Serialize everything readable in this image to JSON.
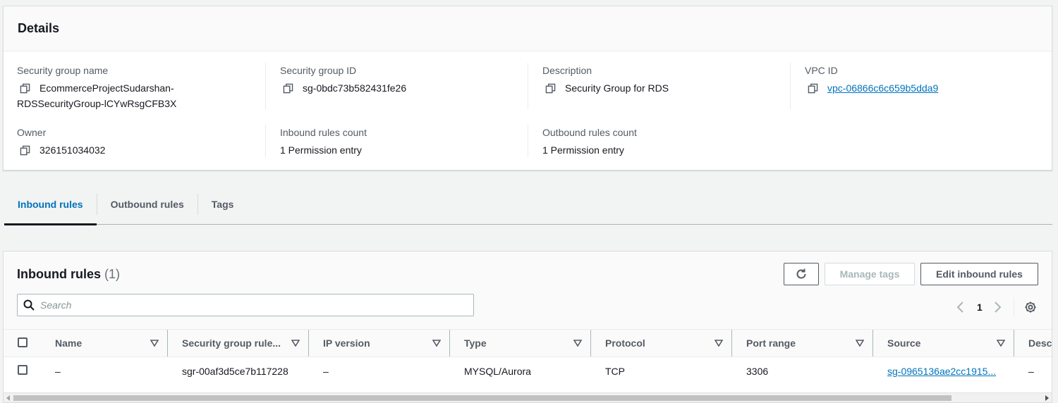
{
  "details": {
    "title": "Details",
    "fields": {
      "sg_name_label": "Security group name",
      "sg_name_value_1": "EcommerceProjectSudarshan-",
      "sg_name_value_2": "RDSSecurityGroup-lCYwRsgCFB3X",
      "sg_id_label": "Security group ID",
      "sg_id_value": "sg-0bdc73b582431fe26",
      "description_label": "Description",
      "description_value": "Security Group for RDS",
      "vpc_label": "VPC ID",
      "vpc_value": "vpc-06866c6c659b5dda9",
      "owner_label": "Owner",
      "owner_value": "326151034032",
      "inbound_count_label": "Inbound rules count",
      "inbound_count_value": "1 Permission entry",
      "outbound_count_label": "Outbound rules count",
      "outbound_count_value": "1 Permission entry"
    }
  },
  "tabs": [
    {
      "label": "Inbound rules",
      "active": true
    },
    {
      "label": "Outbound rules",
      "active": false
    },
    {
      "label": "Tags",
      "active": false
    }
  ],
  "rules": {
    "title": "Inbound rules",
    "count": "(1)",
    "refresh_icon": "refresh-icon",
    "manage_tags_label": "Manage tags",
    "edit_label": "Edit inbound rules",
    "search_placeholder": "Search",
    "page_number": "1",
    "columns": [
      "Name",
      "Security group rule...",
      "IP version",
      "Type",
      "Protocol",
      "Port range",
      "Source",
      "Descr"
    ],
    "rows": [
      {
        "name": "–",
        "rule_id": "sgr-00af3d5ce7b117228",
        "ip_version": "–",
        "type": "MYSQL/Aurora",
        "protocol": "TCP",
        "port_range": "3306",
        "source": "sg-0965136ae2cc1915...",
        "description": "–"
      }
    ]
  },
  "colors": {
    "link": "#0073bb",
    "active_tab": "#0073bb",
    "text": "#16191f",
    "muted": "#545b64"
  }
}
